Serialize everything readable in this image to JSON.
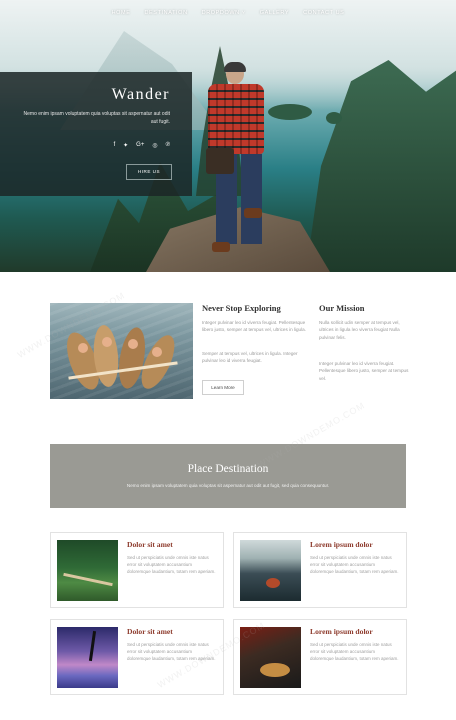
{
  "nav": {
    "items": [
      "HOME",
      "DESTINATION",
      "DROPDOWN ˅",
      "GALLERY",
      "CONTACT US"
    ]
  },
  "hero": {
    "title": "Wander",
    "description": "Nemo enim ipsam voluptatem quia voluptas sit aspernatur aut odit aut fugit.",
    "social_icons": [
      "f",
      "✦",
      "G+",
      "◎",
      "℗"
    ],
    "social_icon_names": [
      "facebook-icon",
      "twitter-icon",
      "google-plus-icon",
      "instagram-icon",
      "pinterest-icon"
    ],
    "hire_label": "HIRE US"
  },
  "about": {
    "col1": {
      "title": "Never Stop Exploring",
      "p1": "Integer pulvinar leo id viverra feugiat. Pellentesque libero justo, semper at tempus vel, ultrices in ligula.",
      "p2": "Semper at tempus vel, ultrices in ligula. Integer pulvinar leo id viverra feugiat.",
      "button": "Learn More"
    },
    "col2": {
      "title": "Our Mission",
      "p1": "Nulla sollicit udin semper at tempus vel, ultrices in ligula leo viverra feugiat Nulla pulvinar felis.",
      "p2": "Integer pulvinar leo id viverra feugiat. Pellentesque libero justo, semper at tempus vel."
    }
  },
  "banner": {
    "title": "Place Destination",
    "subtitle": "Nemo enim ipsam voluptatem quia voluptas sit aspernatur aut odit aut fugit, sed quia consequuntur."
  },
  "cards": [
    {
      "title": "Dolor sit amet",
      "text": "Sed ut perspiciatis unde omnis iste natus error sit voluptatem accusantium doloremque laudantium, totam rem aperiam."
    },
    {
      "title": "Lorem ipsum dolor",
      "text": "Sed ut perspiciatis unde omnis iste natus error sit voluptatem accusantium doloremque laudantium, totam rem aperiam."
    },
    {
      "title": "Dolor sit amet",
      "text": "Sed ut perspiciatis unde omnis iste natus error sit voluptatem accusantium doloremque laudantium, totam rem aperiam."
    },
    {
      "title": "Lorem ipsum dolor",
      "text": "Sed ut perspiciatis unde omnis iste natus error sit voluptatem accusantium doloremque laudantium, totam rem aperiam."
    }
  ],
  "colors": {
    "card_title": "#8e3c2e",
    "banner_bg": "#9a9a94",
    "hero_box_bg": "#1c2626"
  },
  "watermark": "WWW.DOWNDEMO.COM"
}
